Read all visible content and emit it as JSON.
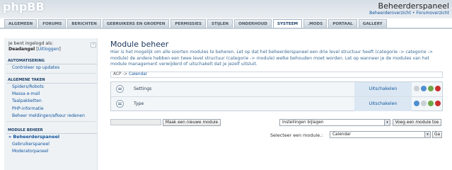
{
  "header": {
    "logo": "phpBB",
    "site_title": "Beheerderspaneel",
    "link_overview": "Beheerderoverzicht",
    "link_separator": "•",
    "link_forum": "Forumoverzicht"
  },
  "tabs": [
    {
      "label": "Algemeen",
      "active": false
    },
    {
      "label": "Forums",
      "active": false
    },
    {
      "label": "Berichten",
      "active": false
    },
    {
      "label": "Gebruikers en groepen",
      "active": false
    },
    {
      "label": "Permissies",
      "active": false
    },
    {
      "label": "Stijlen",
      "active": false
    },
    {
      "label": "Onderhoud",
      "active": false
    },
    {
      "label": "Systeem",
      "active": true
    },
    {
      "label": ".Mods",
      "active": false
    },
    {
      "label": "Portaal",
      "active": false
    },
    {
      "label": "Gallery",
      "active": false
    }
  ],
  "sidebar": {
    "login_label": "Je bent ingelogd als:",
    "username": "Deadangel",
    "logout_open": "[",
    "logout": "Uitloggen",
    "logout_close": "]",
    "collapse_icon": "«",
    "sections": [
      {
        "title": "Automatisering",
        "items": [
          "Controleer op updates"
        ]
      },
      {
        "title": "Algemene taken",
        "items": [
          "Spiders/Robots",
          "Massa e-mail",
          "Taalpakketten",
          "PHP-informatie",
          "Beheer meldingen/afkeur redenen"
        ]
      },
      {
        "title": "Module beheer",
        "items": [
          "Beheerderspaneel",
          "Gebruikerspaneel",
          "Moderatorpaneel"
        ],
        "current": "Beheerderspaneel"
      }
    ]
  },
  "main": {
    "title": "Module beheer",
    "intro": "Hier is het mogelijk om alle soorten modules te beheren. Let op dat het beheerderspaneel een drie level structuur heeft (categorie -> categorie -> module) de andere hebben een twee level structuur (categorie -> module) welke behouden moet worden. Let op wanneer je de modules van het module management verwijderd of uitschakelt dat je jezelf uitsluit.",
    "breadcrumb_root": "ACP",
    "breadcrumb_sep": "->",
    "breadcrumb_current": "Calendar",
    "modules": [
      {
        "name": "Settings",
        "action": "Uitschakelen"
      },
      {
        "name": "Type",
        "action": "Uitschakelen"
      }
    ],
    "new_module_input": "",
    "new_module_button": "Maak een nieuwe module",
    "attach_select": "Instellingen bijlagen",
    "add_module_button": "Voeg een module toe",
    "select_module_label": "Selecteer een module.:",
    "select_module_value": "Calendar",
    "go_button": "Ga",
    "dropdown_icon": "▾"
  }
}
